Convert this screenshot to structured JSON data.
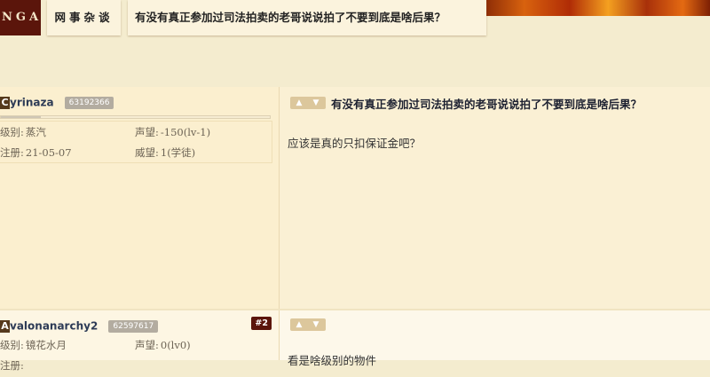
{
  "nav": {
    "logo": "NGA",
    "forum": "网事杂谈",
    "topic": "有没有真正参加过司法拍卖的老哥说说拍了不要到底是啥后果？"
  },
  "posts": [
    {
      "avatar_letter": "C",
      "username": "yrinaza",
      "uid": "63192366",
      "floor": "",
      "level_label": "级别:",
      "level": "蒸汽",
      "reputation_label": "声望:",
      "reputation": "-150(lv-1)",
      "reg_label": "注册:",
      "reg_date": "21-05-07",
      "prestige_label": "威望:",
      "prestige": "1(学徒)",
      "title": "有没有真正参加过司法拍卖的老哥说说拍了不要到底是啥后果？",
      "content": "应该是真的只扣保证金吧？"
    },
    {
      "avatar_letter": "A",
      "username": "valonanarchy2",
      "uid": "62597617",
      "floor": "#2",
      "level_label": "级别:",
      "level": "镜花水月",
      "reputation_label": "声望:",
      "reputation": "0(lv0)",
      "reg_label": "注册:",
      "content": "看是啥级别的物件"
    }
  ],
  "icons": {
    "vote_up": "thumbs-up-icon",
    "vote_down": "thumbs-down-icon"
  },
  "colors": {
    "page_bg": "#f4eccf",
    "logo_bg": "#5b150b",
    "username": "#2d3b56",
    "uid_badge": "#b3aca0",
    "vote_badge": "#dcc79c"
  }
}
